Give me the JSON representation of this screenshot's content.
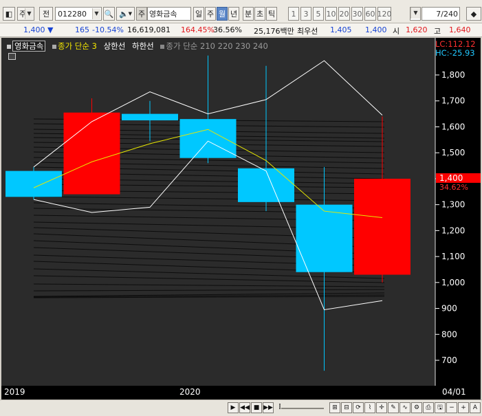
{
  "toolbar": {
    "period_selector": "주",
    "prev_label": "전",
    "code_value": "012280",
    "stock_tag": "주",
    "stock_name": "영화금속",
    "period_tabs": [
      "일",
      "주",
      "월",
      "년",
      "분",
      "초",
      "틱"
    ],
    "active_tab_index": 2,
    "interval_tabs": [
      "1",
      "3",
      "5",
      "10",
      "20",
      "30",
      "60",
      "120"
    ],
    "counter_value": "7",
    "counter_total": "/240"
  },
  "quote": {
    "price": "1,400",
    "change_arrow": "▼",
    "change": "165",
    "change_pct": "-10.54%",
    "volume": "16,619,081",
    "volume_ratio": "164.45%",
    "turnover": "36.56%",
    "amount": "25,176백만",
    "best_ask_label": "최우선",
    "best_ask": "1,405",
    "best_bid": "1,400",
    "open_label": "시",
    "open": "1,620",
    "high_label": "고",
    "high": "1,640"
  },
  "chart": {
    "legend_stock": "영화금속",
    "legend_ma": "종가 단순 3",
    "legend_upper": "상한선",
    "legend_lower": "하한선",
    "legend_multi": "종가 단순 210 220 230 240",
    "lc_label": "LC:112.12",
    "hc_label": "HC:-25.93",
    "current_price_tag": "1,400",
    "current_pct_tag": "34.62%",
    "x_labels": [
      "2019",
      "2020",
      "04/01"
    ],
    "colors": {
      "up": "#ff0000",
      "down": "#00c8ff",
      "ma": "#e8e800",
      "band": "#ffffff",
      "background": "#2b2b2b"
    }
  },
  "chart_data": {
    "type": "candlestick",
    "y_ticks": [
      700,
      800,
      900,
      1000,
      1100,
      1200,
      1300,
      1400,
      1500,
      1600,
      1700,
      1800
    ],
    "ylim": [
      640,
      1890
    ],
    "candles": [
      {
        "open": 1430,
        "high": 1445,
        "low": 1320,
        "close": 1330
      },
      {
        "open": 1340,
        "high": 1710,
        "low": 1340,
        "close": 1655
      },
      {
        "open": 1650,
        "high": 1700,
        "low": 1545,
        "close": 1625
      },
      {
        "open": 1630,
        "high": 1875,
        "low": 1460,
        "close": 1480
      },
      {
        "open": 1440,
        "high": 1835,
        "low": 1275,
        "close": 1310
      },
      {
        "open": 1300,
        "high": 1445,
        "low": 660,
        "close": 1040
      },
      {
        "open": 1030,
        "high": 1640,
        "low": 1000,
        "close": 1400
      }
    ],
    "ma3": [
      1365,
      1465,
      1535,
      1590,
      1470,
      1275,
      1250
    ],
    "upper_band": [
      1445,
      1620,
      1735,
      1650,
      1705,
      1855,
      1645
    ],
    "lower_band": [
      1320,
      1270,
      1290,
      1545,
      1430,
      895,
      930
    ]
  }
}
